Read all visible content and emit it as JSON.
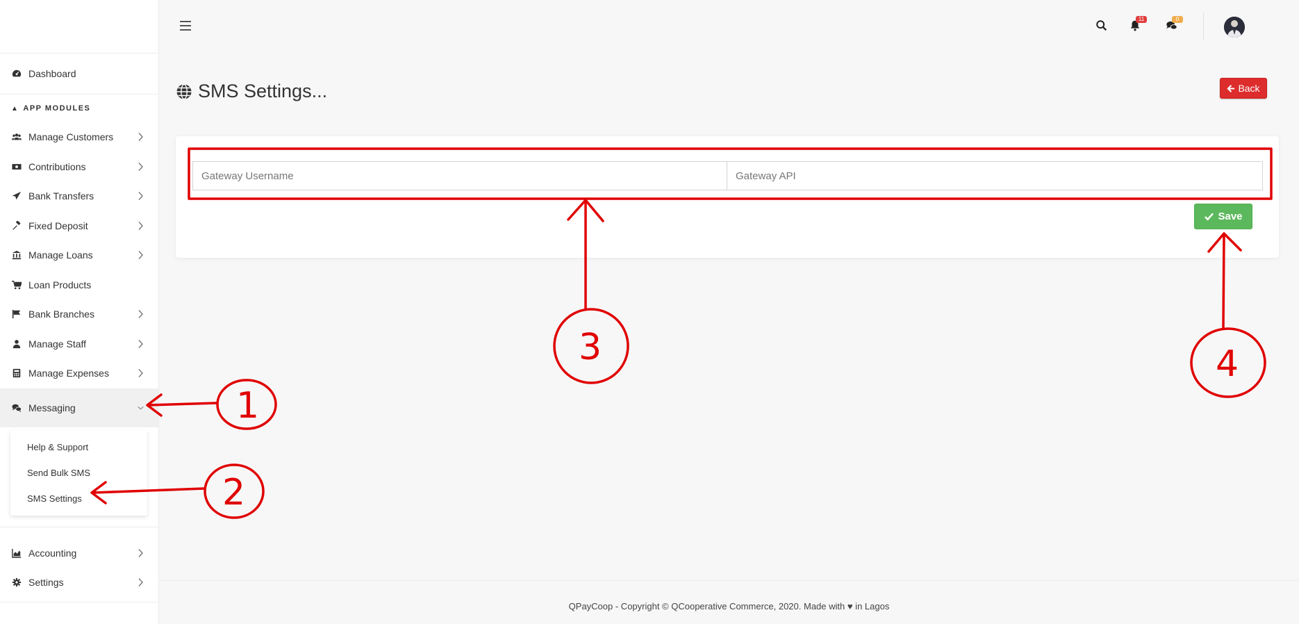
{
  "sidebar": {
    "dashboard": "Dashboard",
    "section_title": "APP MODULES",
    "items": [
      {
        "label": "Manage Customers",
        "icon": "users-icon"
      },
      {
        "label": "Contributions",
        "icon": "money-icon"
      },
      {
        "label": "Bank Transfers",
        "icon": "paper-plane-icon"
      },
      {
        "label": "Fixed Deposit",
        "icon": "gavel-icon"
      },
      {
        "label": "Manage Loans",
        "icon": "bank-icon"
      },
      {
        "label": "Loan Products",
        "icon": "cart-icon"
      },
      {
        "label": "Bank Branches",
        "icon": "flag-icon"
      },
      {
        "label": "Manage Staff",
        "icon": "user-icon"
      },
      {
        "label": "Manage Expenses",
        "icon": "calculator-icon"
      },
      {
        "label": "Messaging",
        "icon": "comments-icon"
      }
    ],
    "submenu": [
      "Help & Support",
      "Send Bulk SMS",
      "SMS Settings"
    ],
    "bottom_items": [
      {
        "label": "Accounting",
        "icon": "area-chart-icon"
      },
      {
        "label": "Settings",
        "icon": "gear-icon"
      }
    ]
  },
  "topbar": {
    "notifications_count": "11",
    "messages_count": "0"
  },
  "main": {
    "title": "SMS Settings...",
    "back_label": "Back",
    "gateway_username_placeholder": "Gateway Username",
    "gateway_api_placeholder": "Gateway API",
    "save_label": "Save"
  },
  "footer": {
    "text": "QPayCoop - Copyright © QCooperative Commerce, 2020. Made with ♥ in Lagos"
  },
  "annotations": {
    "color": "#e00000",
    "labels": [
      "1",
      "2",
      "3",
      "4"
    ]
  }
}
